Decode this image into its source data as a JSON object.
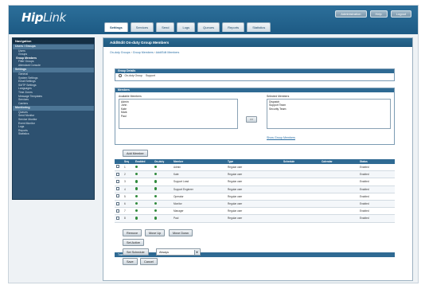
{
  "header": {
    "logo_main": "Hip",
    "logo_accent": "Link",
    "top_buttons": [
      "Administration",
      "Help",
      "Logout"
    ],
    "tabs": [
      "Settings",
      "Services",
      "Send",
      "Logs",
      "Queues",
      "Reports",
      "Statistics"
    ],
    "active_tab": 0
  },
  "sidebar": {
    "head": "Navigation",
    "sections": [
      {
        "title": "Users / Groups",
        "items": [
          "Users",
          "Groups",
          "Group Members",
          "Filter Groups",
          "Attendant Console"
        ]
      },
      {
        "title": "Settings",
        "items": [
          "General",
          "System Settings",
          "Email Settings",
          "SMTP Settings",
          "Languages",
          "Time Zones",
          "Message Templates",
          "Services",
          "Carriers"
        ]
      },
      {
        "title": "Monitoring",
        "items": [
          "Queues",
          "Send Monitor",
          "Service Monitor",
          "Event Monitor",
          "Logs",
          "Reports",
          "Statistics"
        ]
      }
    ]
  },
  "main": {
    "title": "Add/Edit On-duty Group Members",
    "breadcrumb": [
      "On-duty Groups",
      "Group Members",
      "Add/Edit Members"
    ],
    "group_box": {
      "head": "Group Details",
      "group_label": "On-duty Group",
      "group_name": "Support"
    },
    "members_box": {
      "head": "Members",
      "left_label": "Available Members",
      "right_label": "Selected Members",
      "left_items": [
        "Admin",
        "John",
        "Kate",
        "Mark",
        "Paul"
      ],
      "right_items": [
        "Dispatch",
        "Support Team",
        "Security Team"
      ],
      "move_label": ">>",
      "link": "Show Group Members"
    },
    "add_button": "Add Member",
    "table": {
      "columns": [
        "",
        "Seq",
        "Enabled",
        "On-duty",
        "Member",
        "Type",
        "Schedule",
        "Calendar",
        "Status"
      ],
      "rows": [
        [
          "",
          "1",
          "",
          "",
          "Admin",
          "Regular user",
          "",
          "",
          "Enabled"
        ],
        [
          "",
          "2",
          "",
          "",
          "Kate",
          "Regular user",
          "",
          "",
          "Enabled"
        ],
        [
          "",
          "3",
          "",
          "",
          "Support Lead",
          "Regular user",
          "",
          "",
          "Enabled"
        ],
        [
          "",
          "4",
          "",
          "",
          "Support Engineer",
          "Regular user",
          "",
          "",
          "Enabled"
        ],
        [
          "",
          "5",
          "",
          "",
          "Operator",
          "Regular user",
          "",
          "",
          "Enabled"
        ],
        [
          "",
          "6",
          "",
          "",
          "Monitor",
          "Regular user",
          "",
          "",
          "Enabled"
        ],
        [
          "",
          "7",
          "",
          "",
          "Manager",
          "Regular user",
          "",
          "",
          "Enabled"
        ],
        [
          "",
          "8",
          "",
          "",
          "Paul",
          "Regular user",
          "",
          "",
          "Enabled"
        ]
      ]
    },
    "footer_bar": "Total: 8 members",
    "buttons": {
      "row1": [
        "Remove",
        "Move Up",
        "Move Down"
      ],
      "row2": "Set Active",
      "row3_label": "Set Schedule",
      "select_value": "Always",
      "row4": [
        "Save",
        "Cancel"
      ]
    }
  },
  "colors": {
    "header": "#1d5a84",
    "sidebar": "#2d5170",
    "accent": "#2f6a93"
  }
}
